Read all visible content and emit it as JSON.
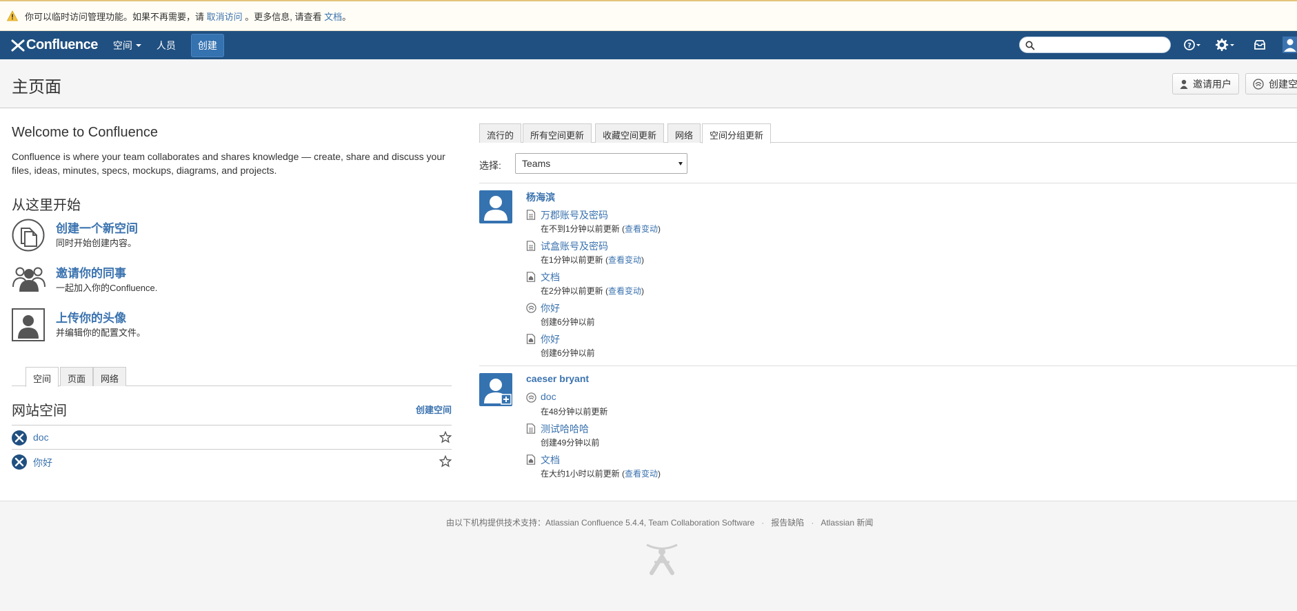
{
  "warning": {
    "prefix": "你可以临时访问管理功能。如果不再需要，请 ",
    "cancel_link": "取消访问",
    "middle": " 。更多信息, 请查看 ",
    "doc_link": "文档",
    "suffix": "。"
  },
  "nav": {
    "logo": "Confluence",
    "spaces": "空间",
    "people": "人员",
    "create": "创建"
  },
  "header": {
    "title": "主页面",
    "invite_button": "邀请用户",
    "create_space_button": "创建空"
  },
  "welcome": {
    "title": "Welcome to Confluence",
    "text": "Confluence is where your team collaborates and shares knowledge — create, share and discuss your files, ideas, minutes, specs, mockups, diagrams, and projects."
  },
  "start": {
    "title": "从这里开始",
    "items": [
      {
        "title": "创建一个新空间",
        "desc": "同时开始创建内容。"
      },
      {
        "title": "邀请你的同事",
        "desc": "一起加入你的Confluence."
      },
      {
        "title": "上传你的头像",
        "desc": "并编辑你的配置文件。"
      }
    ]
  },
  "left_tabs": [
    "空间",
    "页面",
    "网络"
  ],
  "spaces_section": {
    "title": "网站空间",
    "create_link": "创建空间",
    "items": [
      "doc",
      "你好"
    ]
  },
  "right_tabs": [
    "流行的",
    "所有空间更新",
    "收藏空间更新",
    "网络",
    "空间分组更新"
  ],
  "select": {
    "label": "选择:",
    "value": "Teams"
  },
  "groups": [
    {
      "user": "杨海滨",
      "updates": [
        {
          "icon": "page-icon",
          "title": "万郡账号及密码",
          "meta": "在不到1分钟以前更新 (",
          "link": "查看变动",
          "meta_end": ")"
        },
        {
          "icon": "page-icon",
          "title": "试盒账号及密码",
          "meta": "在1分钟以前更新 (",
          "link": "查看变动",
          "meta_end": ")"
        },
        {
          "icon": "home-page-icon",
          "title": "文档",
          "meta": "在2分钟以前更新 (",
          "link": "查看变动",
          "meta_end": ")"
        },
        {
          "icon": "space-icon",
          "title": "你好",
          "meta": "创建6分钟以前",
          "link": "",
          "meta_end": ""
        },
        {
          "icon": "home-page-icon",
          "title": "你好",
          "meta": "创建6分钟以前",
          "link": "",
          "meta_end": ""
        }
      ]
    },
    {
      "user": "caeser bryant",
      "updates": [
        {
          "icon": "space-icon",
          "title": "doc",
          "meta": "在48分钟以前更新",
          "link": "",
          "meta_end": ""
        },
        {
          "icon": "page-icon",
          "title": "测试哈哈哈",
          "meta": "创建49分钟以前",
          "link": "",
          "meta_end": ""
        },
        {
          "icon": "home-page-icon",
          "title": "文档",
          "meta": "在大约1小时以前更新 (",
          "link": "查看变动",
          "meta_end": ")"
        }
      ]
    }
  ],
  "footer": {
    "powered": "由以下机构提供技术支持：Atlassian Confluence 5.4.4, Team Collaboration Software",
    "report": "报告缺陷",
    "news": "Atlassian 新闻"
  }
}
